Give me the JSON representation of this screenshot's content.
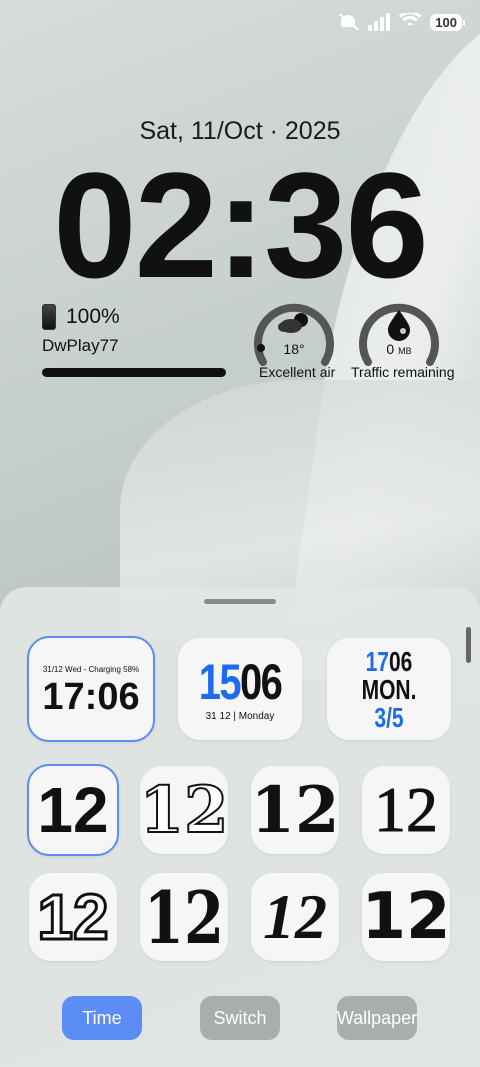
{
  "status_bar": {
    "icons": [
      "mute-icon",
      "signal-icon",
      "wifi-icon"
    ],
    "battery": "100"
  },
  "lockscreen": {
    "date": "Sat, 11/Oct · 2025",
    "time": "02:36",
    "battery_widget": {
      "percent": "100%",
      "device": "DwPlay77",
      "level": 1.0
    },
    "weather_widget": {
      "temp": "18°",
      "label": "Excellent air",
      "icon": "cloud-sun-icon"
    },
    "traffic_widget": {
      "value": "0",
      "unit": "MB",
      "label": "Traffic remaining",
      "icon": "water-drop-icon"
    }
  },
  "style_sheet": {
    "widgets": [
      {
        "top_text": "31/12 Wed - Charging 58%",
        "time": "17:06"
      },
      {
        "time_blue": "15",
        "time_black": "06",
        "sub": "31 12 | Monday"
      },
      {
        "line1_blue": "17",
        "line1_black": "06",
        "line2": "MON.",
        "line3": "3/5"
      }
    ],
    "font_styles": [
      "12",
      "12",
      "12",
      "12",
      "12",
      "12",
      "12",
      "12"
    ],
    "tabs": {
      "time": "Time",
      "switch": "Switch",
      "wallpaper": "Wallpaper"
    }
  },
  "colors": {
    "accent": "#5b8df5",
    "blue_digits": "#1d6cf0",
    "tab_inactive": "#a9aeac"
  }
}
